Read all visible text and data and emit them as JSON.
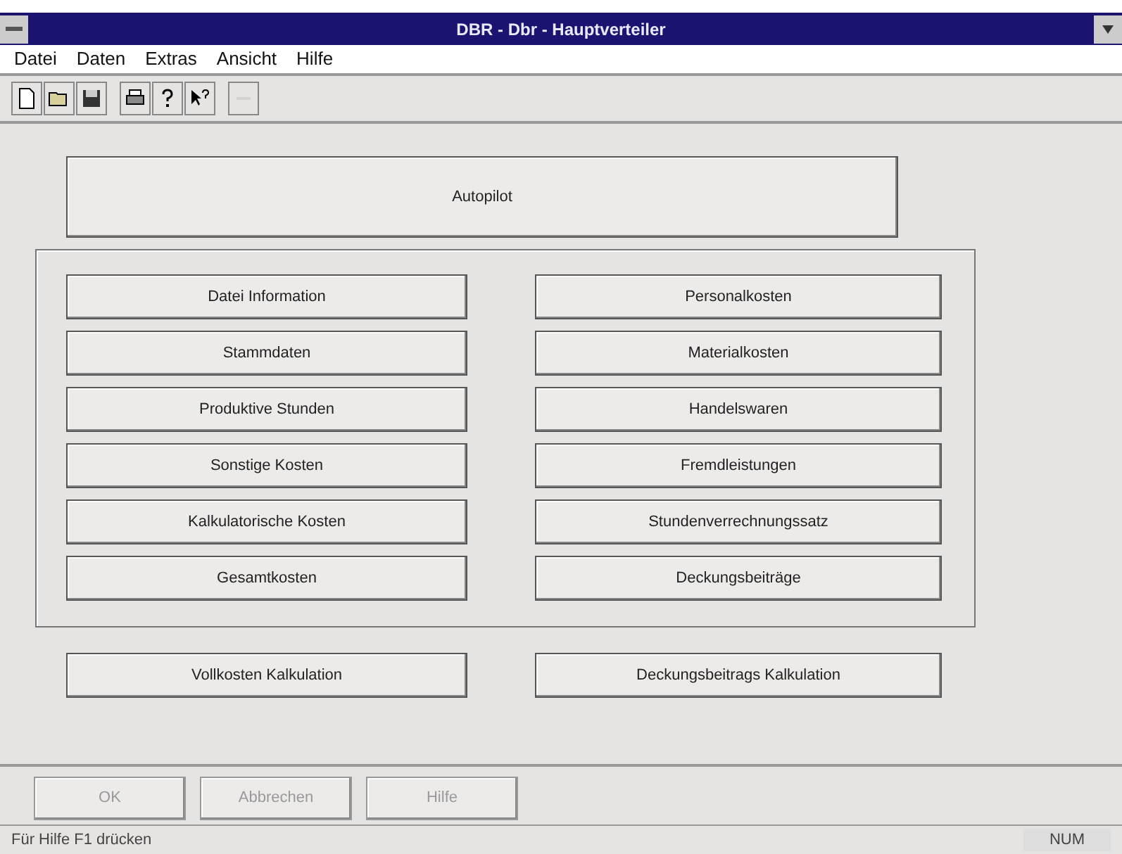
{
  "window": {
    "title": "DBR - Dbr - Hauptverteiler"
  },
  "menu": [
    "Datei",
    "Daten",
    "Extras",
    "Ansicht",
    "Hilfe"
  ],
  "toolbar": [
    {
      "kind": "new",
      "disabled": false
    },
    {
      "kind": "open",
      "disabled": false
    },
    {
      "kind": "save",
      "disabled": false
    },
    {
      "kind": "print",
      "disabled": false
    },
    {
      "kind": "help",
      "disabled": false
    },
    {
      "kind": "context-help",
      "disabled": false
    },
    {
      "kind": "blank",
      "disabled": true
    }
  ],
  "autopilot": "Autopilot",
  "left_buttons": [
    "Datei Information",
    "Stammdaten",
    "Produktive Stunden",
    "Sonstige Kosten",
    "Kalkulatorische Kosten",
    "Gesamtkosten"
  ],
  "right_buttons": [
    "Personalkosten",
    "Materialkosten",
    "Handelswaren",
    "Fremdleistungen",
    "Stundenverrechnungssatz",
    "Deckungsbeiträge"
  ],
  "calc_buttons": [
    "Vollkosten Kalkulation",
    "Deckungsbeitrags Kalkulation"
  ],
  "dialog_buttons": [
    {
      "label": "OK",
      "disabled": true
    },
    {
      "label": "Abbrechen",
      "disabled": true
    },
    {
      "label": "Hilfe",
      "disabled": true
    }
  ],
  "status_bar": {
    "message": "Für Hilfe F1 drücken",
    "indicator": "NUM"
  }
}
